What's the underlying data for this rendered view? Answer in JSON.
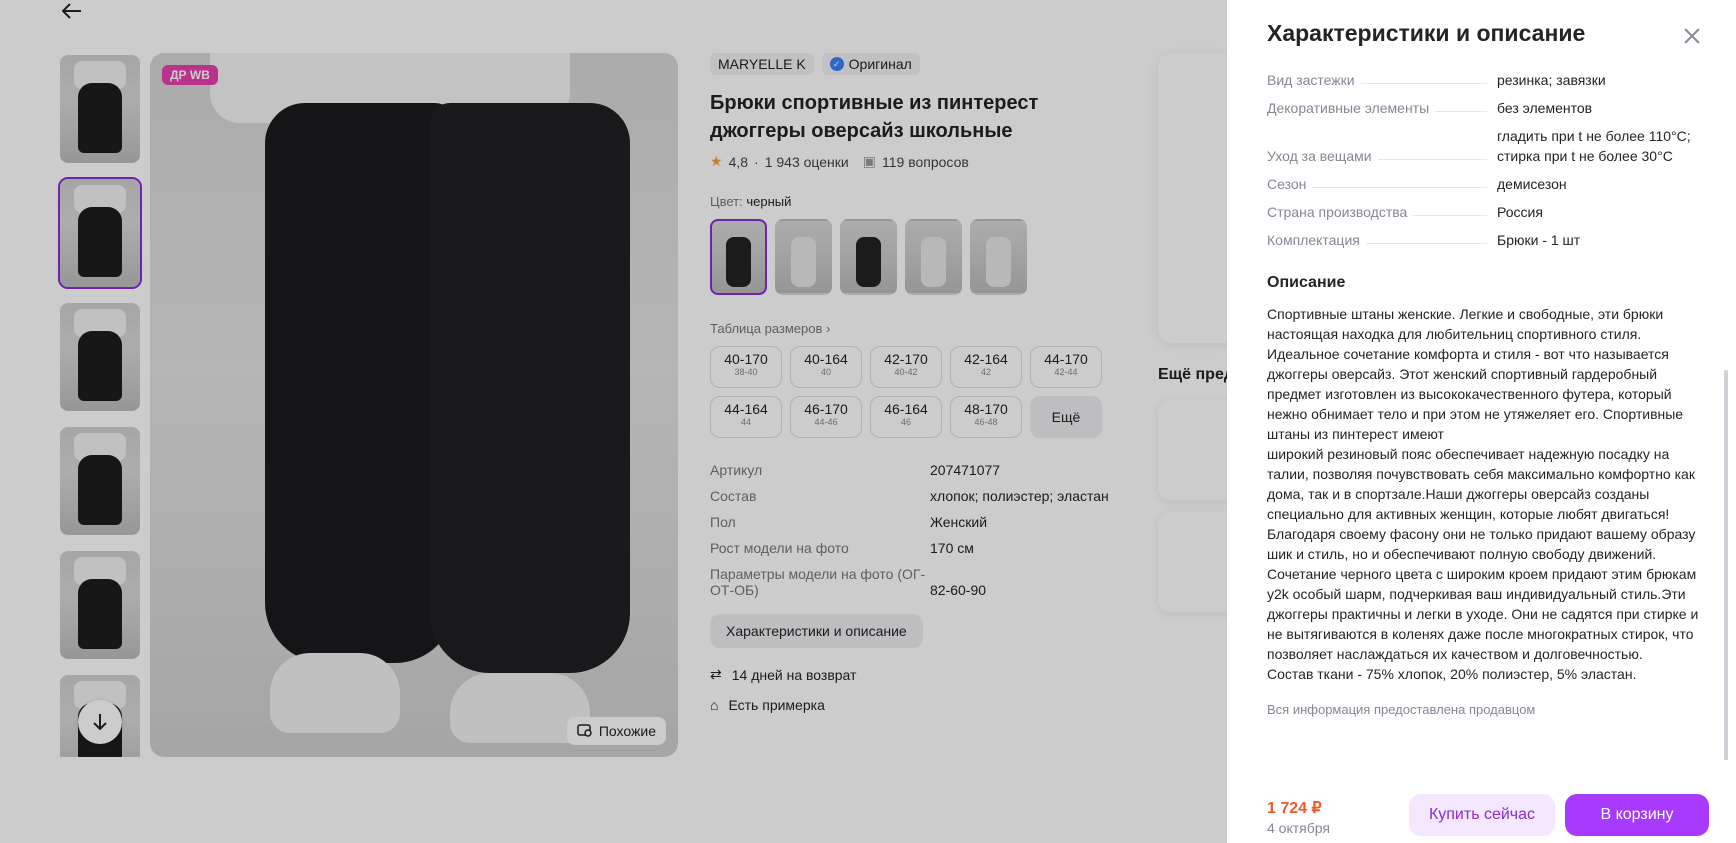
{
  "product": {
    "brand": "MARYELLE K",
    "original_label": "Оригинал",
    "title": "Брюки спортивные из пинтерест джоггеры оверсайз школьные",
    "rating": "4,8",
    "reviews": "1 943 оценки",
    "questions": "119 вопросов",
    "color_label": "Цвет:",
    "color_value": "черный",
    "badge": "ДР WB",
    "similar_label": "Похожие",
    "size_table_label": "Таблица размеров",
    "sizes": [
      {
        "size": "40-170",
        "ru": "38-40"
      },
      {
        "size": "40-164",
        "ru": "40"
      },
      {
        "size": "42-170",
        "ru": "40-42"
      },
      {
        "size": "42-164",
        "ru": "42"
      },
      {
        "size": "44-170",
        "ru": "42-44"
      },
      {
        "size": "44-164",
        "ru": "44"
      },
      {
        "size": "46-170",
        "ru": "44-46"
      },
      {
        "size": "46-164",
        "ru": "46"
      },
      {
        "size": "48-170",
        "ru": "46-48"
      }
    ],
    "sizes_more": "Ещё",
    "specs": [
      {
        "k": "Артикул",
        "v": "207471077"
      },
      {
        "k": "Состав",
        "v": "хлопок; полиэстер; эластан"
      },
      {
        "k": "Пол",
        "v": "Женский"
      },
      {
        "k": "Рост модели на фото",
        "v": "170 см"
      },
      {
        "k": "Параметры модели на фото (ОГ-ОТ-ОБ)",
        "v": "82-60-90"
      }
    ],
    "specs_button": "Характеристики и описание",
    "return_label": "14 дней на возврат",
    "fitting_label": "Есть примерка",
    "more_title": "Ещё пред"
  },
  "panel": {
    "title": "Характеристики и описание",
    "specs": [
      {
        "k": "Вид застежки",
        "v": "резинка; завязки"
      },
      {
        "k": "Декоративные элементы",
        "v": "без элементов"
      },
      {
        "k": "Уход за вещами",
        "v": "гладить при t не более 110°С; стирка при t не более 30°С"
      },
      {
        "k": "Сезон",
        "v": "демисезон"
      },
      {
        "k": "Страна производства",
        "v": "Россия"
      },
      {
        "k": "Комплектация",
        "v": "Брюки - 1 шт"
      }
    ],
    "description_title": "Описание",
    "description": "Спортивные штаны женские. Легкие и свободные, эти брюки настоящая находка для любительниц спортивного стиля. Идеальное сочетание комфорта и стиля - вот что называется джоггеры оверсайз. Этот женский спортивный гардеробный предмет изготовлен из высококачественного футера, который нежно обнимает тело и при этом не утяжеляет его. Спортивные штаны из пинтерест имеют\nширокий резиновый пояс обеспечивает надежную посадку на талии, позволяя почувствовать себя максимально комфортно как дома, так и в спортзале.Наши джоггеры оверсайз созданы специально для активных женщин, которые любят двигаться! Благодаря своему фасону они не только придают вашему образу шик и стиль, но и обеспечивают полную свободу движений. Сочетание черного цвета с широким кроем придают этим брюкам y2k особый шарм, подчеркивая ваш индивидуальный стиль.Эти джоггеры практичны и легки в уходе. Они не садятся при стирке и не вытягиваются в коленях даже после многократных стирок, что позволяет наслаждаться их качеством и долговечностью.\nСостав ткани - 75% хлопок, 20% полиэстер, 5% эластан.",
    "seller_note": "Вся информация предоставлена продавцом",
    "price": "1 724 ₽",
    "delivery_date": "4 октября",
    "buy_now": "Купить сейчас",
    "to_cart": "В корзину"
  },
  "colors": {
    "accent": "#a73afd",
    "accent_light": "#f3e8ff",
    "price": "#f05a2a",
    "overlay": "rgba(0,0,0,0.2)"
  }
}
